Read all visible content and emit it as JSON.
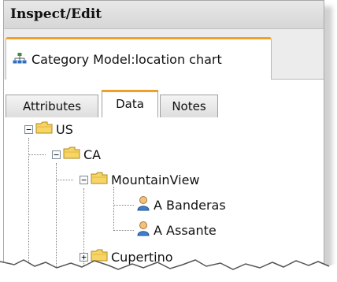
{
  "window": {
    "title": "Inspect/Edit"
  },
  "model_tab": {
    "label": "Category Model:location chart",
    "icon": "hierarchy-icon"
  },
  "tabs": [
    {
      "label": "Attributes",
      "active": false
    },
    {
      "label": "Data",
      "active": true
    },
    {
      "label": "Notes",
      "active": false
    }
  ],
  "tree": {
    "us": {
      "label": "US",
      "expanded": true,
      "icon": "folder-icon"
    },
    "ca": {
      "label": "CA",
      "expanded": true,
      "icon": "folder-icon"
    },
    "mountainview": {
      "label": "MountainView",
      "expanded": true,
      "icon": "folder-icon"
    },
    "banderas": {
      "label": "A Banderas",
      "icon": "user-icon"
    },
    "assante": {
      "label": "A Assante",
      "icon": "user-icon"
    },
    "cupertino": {
      "label": "Cupertino",
      "expanded": false,
      "icon": "folder-icon"
    }
  },
  "colors": {
    "active_tab_accent": "#f0a028",
    "folder": "#f6d466",
    "border": "#9e9e9e"
  }
}
